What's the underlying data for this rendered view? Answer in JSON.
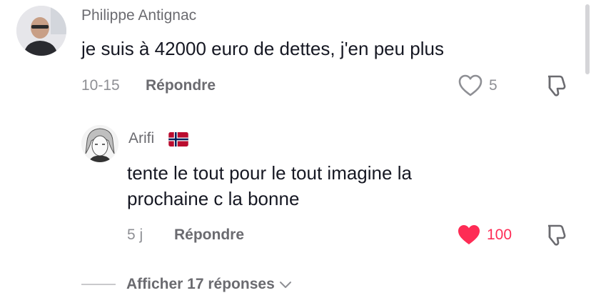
{
  "comments": [
    {
      "username": "Philippe Antignac",
      "text": "je suis à 42000 euro de dettes, j'en peu plus",
      "date": "10-15",
      "reply_label": "Répondre",
      "likes": "5",
      "liked": false
    },
    {
      "username": "Arifi",
      "flag": "norway-flag",
      "text_lines": [
        "tente le tout pour le tout imagine la",
        "prochaine c la bonne"
      ],
      "date": "5 j",
      "reply_label": "Répondre",
      "likes": "100",
      "liked": true
    }
  ],
  "view_replies_label": "Afficher 17 réponses",
  "colors": {
    "liked": "#fe2c55",
    "muted": "#8e8f94",
    "text": "#161823"
  }
}
